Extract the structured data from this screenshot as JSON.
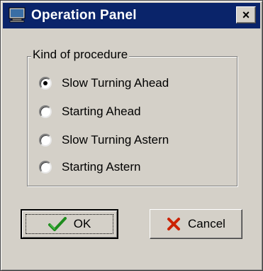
{
  "window": {
    "title": "Operation Panel",
    "close_symbol": "×",
    "title_icon": "window-app-icon",
    "titlebar_color": "#0a246a"
  },
  "group": {
    "legend": "Kind of procedure",
    "options": [
      {
        "label": "Slow Turning Ahead",
        "checked": true
      },
      {
        "label": "Starting Ahead",
        "checked": false
      },
      {
        "label": "Slow Turning Astern",
        "checked": false
      },
      {
        "label": "Starting Astern",
        "checked": false
      }
    ]
  },
  "buttons": {
    "ok_label": "OK",
    "ok_icon": "checkmark-icon",
    "ok_icon_color": "#1e8c1e",
    "cancel_label": "Cancel",
    "cancel_icon": "x-mark-icon",
    "cancel_icon_color": "#cc2200"
  }
}
